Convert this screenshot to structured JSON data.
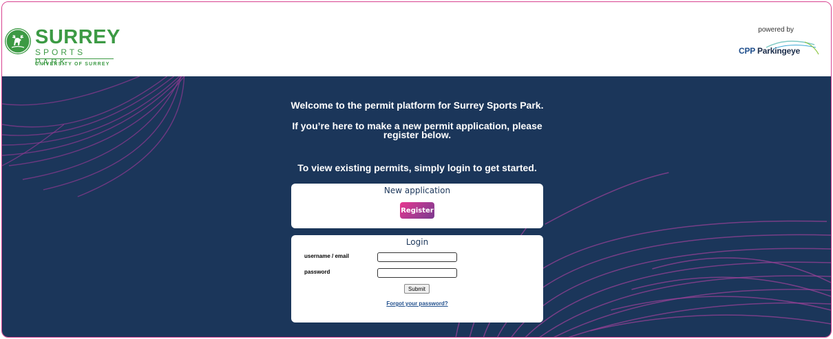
{
  "header": {
    "brand_main": "SURREY",
    "brand_sub": "SPORTS PARK",
    "brand_uni": "UNIVERSITY OF SURREY",
    "powered_by": "powered by",
    "partner_cpp": "CPP",
    "partner_name": "Parkingeye"
  },
  "main": {
    "welcome_1": "Welcome to the permit platform for Surrey Sports Park.",
    "welcome_2a": "If you’re here to make a new permit application, please",
    "welcome_2b": "register below.",
    "welcome_3": "To view existing permits, simply login to get started."
  },
  "new_application": {
    "title": "New application",
    "register_label": "Register"
  },
  "login": {
    "title": "Login",
    "username_label": "username / email",
    "username_value": "",
    "password_label": "password",
    "password_value": "",
    "submit_label": "Submit",
    "forgot_label": "Forgot your password?"
  },
  "colors": {
    "brand_green": "#3c9a44",
    "background_navy": "#1b365a",
    "accent_pink": "#e8368f",
    "accent_purple": "#7b3a8e"
  }
}
